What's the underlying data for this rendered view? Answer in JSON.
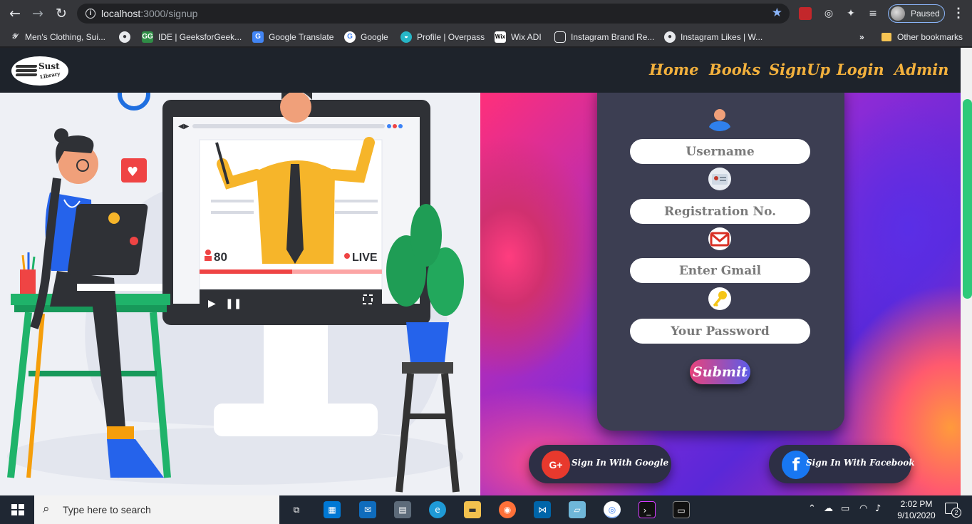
{
  "browser": {
    "url_host": "localhost",
    "url_path": ":3000/signup",
    "profile_label": "Paused",
    "bookmarks": [
      "Men's Clothing, Sui...",
      "IDE | GeeksforGeek...",
      "Google Translate",
      "Google",
      "Profile | Overpass",
      "Wix ADI",
      "Instagram Brand Re...",
      "Instagram Likes | W..."
    ],
    "overflow": "»",
    "other_bookmarks": "Other bookmarks"
  },
  "site": {
    "logo_top": "Sust",
    "logo_bottom": "Library",
    "nav": [
      "Home",
      "Books",
      "SignUp",
      "Login",
      "Admin"
    ]
  },
  "illustration": {
    "viewers": "80",
    "live": "LIVE"
  },
  "form": {
    "username_placeholder": "Username",
    "registration_placeholder": "Registration No.",
    "gmail_placeholder": "Enter Gmail",
    "password_placeholder": "Your Password",
    "submit_label": "Submit"
  },
  "social": {
    "google_label": "Sign In With Google",
    "google_icon": "G+",
    "facebook_label": "Sign In With Facebook",
    "facebook_icon": "f"
  },
  "taskbar": {
    "search_placeholder": "Type here to search",
    "time": "2:02 PM",
    "date": "9/10/2020",
    "notification_count": "2"
  },
  "colors": {
    "nav_link": "#f3b13d",
    "nav_bg": "#1e232b",
    "card_bg": "#3c3e52",
    "google_red": "#e8392d",
    "facebook_blue": "#1877f2"
  }
}
